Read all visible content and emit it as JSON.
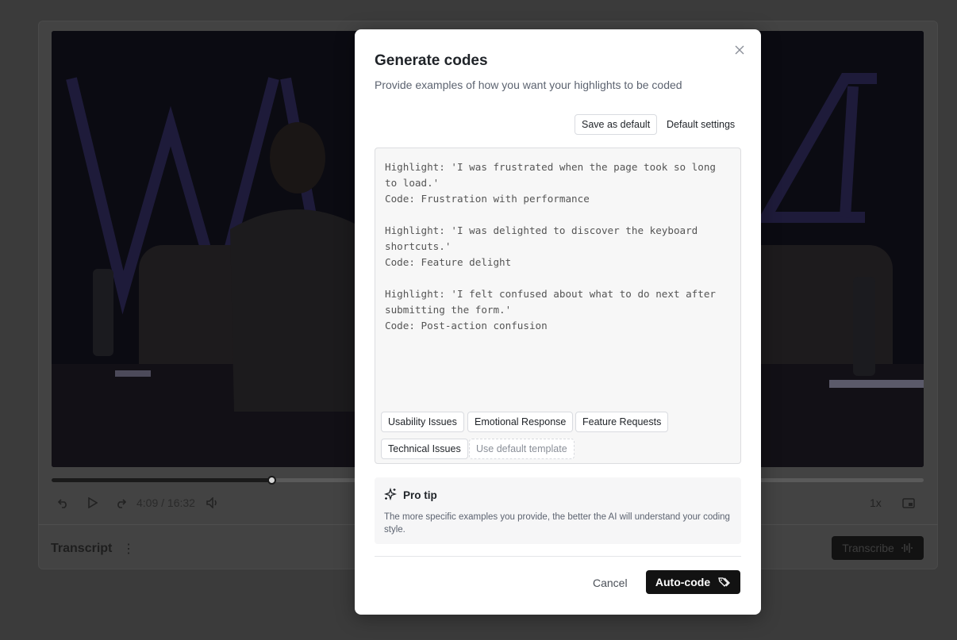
{
  "player": {
    "time_current": "4:09",
    "time_total": "16:32",
    "time_display": "4:09 / 16:32",
    "progress": 0.253,
    "speed": "1x"
  },
  "transcript": {
    "label": "Transcript",
    "transcribe_button": "Transcribe"
  },
  "modal": {
    "title": "Generate codes",
    "subtitle": "Provide examples of how you want your highlights to be coded",
    "save_default_label": "Save as default",
    "default_settings_label": "Default settings",
    "examples_text": "Highlight: 'I was frustrated when the page took so long to load.'\nCode: Frustration with performance\n\nHighlight: 'I was delighted to discover the keyboard shortcuts.'\nCode: Feature delight\n\nHighlight: 'I felt confused about what to do next after submitting the form.'\nCode: Post-action confusion",
    "templates": [
      "Usability Issues",
      "Emotional Response",
      "Feature Requests",
      "Technical Issues"
    ],
    "use_default_template_label": "Use default template",
    "tip": {
      "title": "Pro tip",
      "body": "The more specific examples you provide, the better the AI will understand your coding style."
    },
    "cancel_label": "Cancel",
    "autocode_label": "Auto-code"
  },
  "colors": {
    "overlay": "#3b3b3b",
    "primary_button": "#121212",
    "modal_bg": "#ffffff",
    "editor_bg": "#f7f7f7"
  }
}
